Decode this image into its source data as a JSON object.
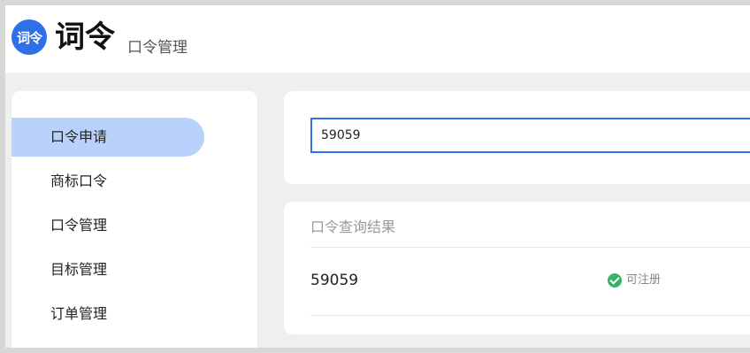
{
  "header": {
    "logo_text": "词令",
    "title": "词令",
    "subtitle": "口令管理"
  },
  "sidebar": {
    "items": [
      {
        "label": "口令申请",
        "active": true
      },
      {
        "label": "商标口令",
        "active": false
      },
      {
        "label": "口令管理",
        "active": false
      },
      {
        "label": "目标管理",
        "active": false
      },
      {
        "label": "订单管理",
        "active": false
      }
    ]
  },
  "search": {
    "value": "59059"
  },
  "results": {
    "heading": "口令查询结果",
    "rows": [
      {
        "value": "59059",
        "status": "可注册",
        "status_icon": "check-circle-icon"
      }
    ]
  },
  "colors": {
    "accent": "#2f6fe8",
    "active_nav": "#b9d2fb",
    "success": "#34b468"
  }
}
